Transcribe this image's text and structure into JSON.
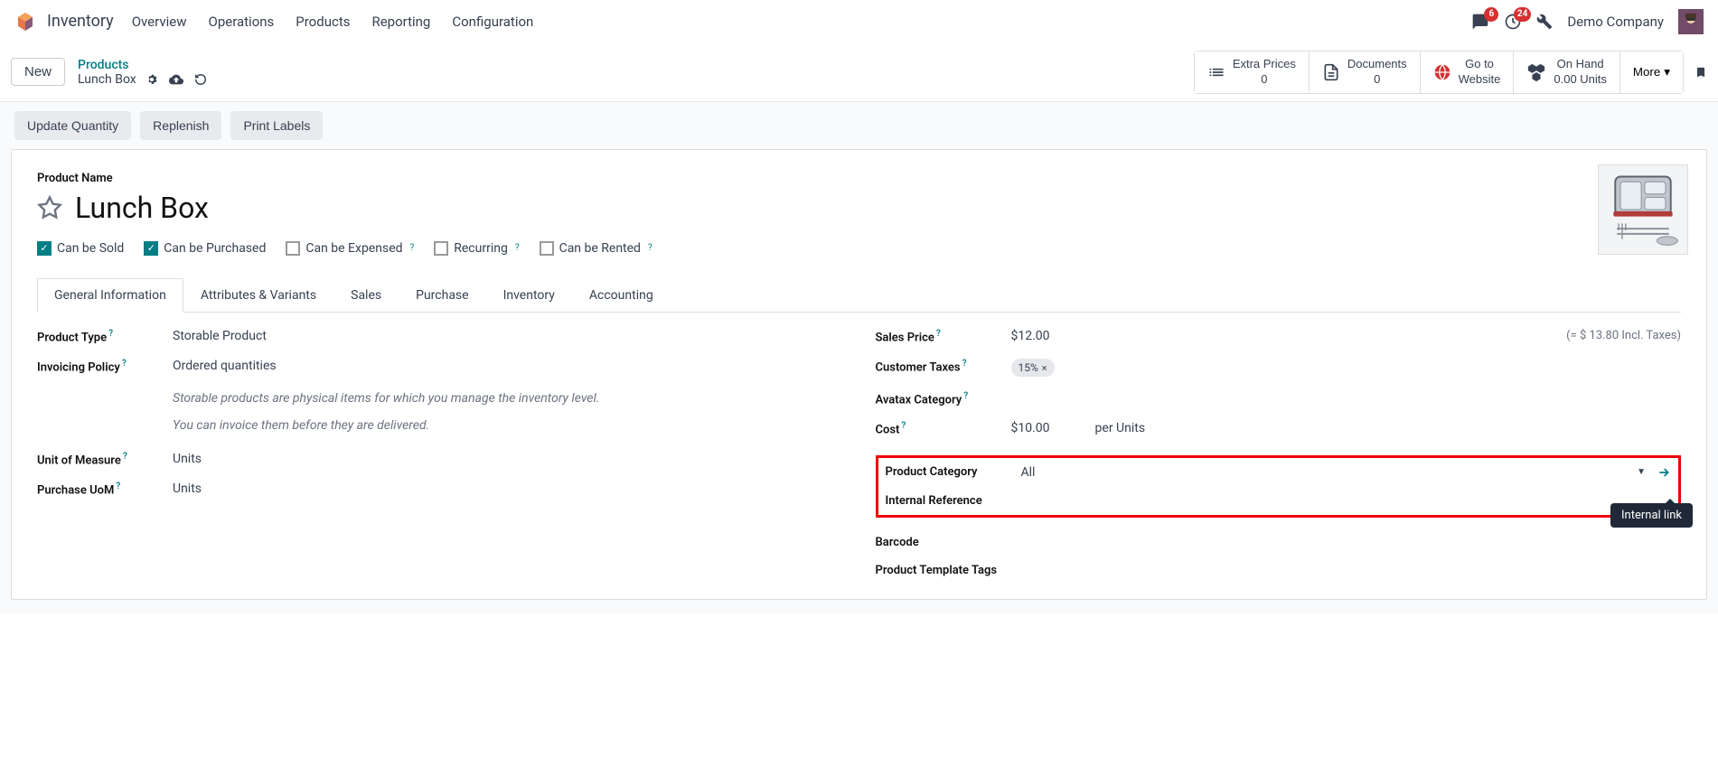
{
  "app": {
    "title": "Inventory",
    "menu": [
      "Overview",
      "Operations",
      "Products",
      "Reporting",
      "Configuration"
    ],
    "messages_badge": "6",
    "activities_badge": "24",
    "company": "Demo Company"
  },
  "breadcrumb": {
    "new_btn": "New",
    "parent": "Products",
    "current": "Lunch Box"
  },
  "stat_buttons": {
    "extra_prices": {
      "label": "Extra Prices",
      "value": "0"
    },
    "documents": {
      "label": "Documents",
      "value": "0"
    },
    "website": {
      "label": "Go to",
      "value": "Website"
    },
    "onhand": {
      "label": "On Hand",
      "value": "0.00 Units"
    },
    "more": "More"
  },
  "actions": {
    "update_qty": "Update Quantity",
    "replenish": "Replenish",
    "print_labels": "Print Labels"
  },
  "form": {
    "product_name_label": "Product Name",
    "title": "Lunch Box",
    "checkboxes": {
      "sold": "Can be Sold",
      "purchased": "Can be Purchased",
      "expensed": "Can be Expensed",
      "recurring": "Recurring",
      "rented": "Can be Rented"
    },
    "tabs": [
      "General Information",
      "Attributes & Variants",
      "Sales",
      "Purchase",
      "Inventory",
      "Accounting"
    ],
    "left_fields": {
      "product_type": {
        "label": "Product Type",
        "value": "Storable Product"
      },
      "invoicing_policy": {
        "label": "Invoicing Policy",
        "value": "Ordered quantities"
      },
      "help_line1": "Storable products are physical items for which you manage the inventory level.",
      "help_line2": "You can invoice them before they are delivered.",
      "uom": {
        "label": "Unit of Measure",
        "value": "Units"
      },
      "purchase_uom": {
        "label": "Purchase UoM",
        "value": "Units"
      }
    },
    "right_fields": {
      "sales_price": {
        "label": "Sales Price",
        "value": "$12.00",
        "incl": "(= $ 13.80 Incl. Taxes)"
      },
      "customer_taxes": {
        "label": "Customer Taxes",
        "tag": "15%"
      },
      "avatax": {
        "label": "Avatax Category"
      },
      "cost": {
        "label": "Cost",
        "value": "$10.00",
        "per": "per Units"
      },
      "category": {
        "label": "Product Category",
        "value": "All"
      },
      "internal_ref": {
        "label": "Internal Reference"
      },
      "barcode": {
        "label": "Barcode"
      },
      "tags": {
        "label": "Product Template Tags"
      }
    },
    "tooltip": "Internal link"
  }
}
